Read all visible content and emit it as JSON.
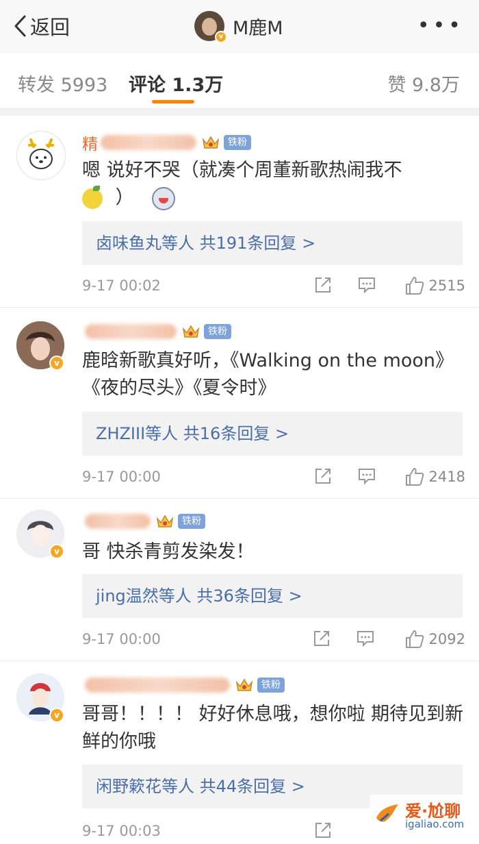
{
  "header": {
    "back_label": "返回",
    "title": "M鹿M",
    "more": "•••"
  },
  "tabs": [
    {
      "label": "转发 5993",
      "active": false
    },
    {
      "label": "评论 1.3万",
      "active": true
    },
    {
      "label": "赞 9.8万",
      "active": false
    }
  ],
  "comments": [
    {
      "username": "精",
      "badge": "铁粉",
      "text_line1": "嗯 说好不哭（就凑个周董新歌热闹我不",
      "text_line2": "）",
      "reply": "卤味鱼丸等人  共191条回复 >",
      "date": "9-17 00:02",
      "likes": "2515"
    },
    {
      "username": "",
      "badge": "铁粉",
      "text": "鹿晗新歌真好听，《Walking on the moon》《夜的尽头》《夏令时》",
      "reply": "ZHZIII等人  共16条回复 >",
      "date": "9-17 00:00",
      "likes": "2418"
    },
    {
      "username": "",
      "badge": "铁粉",
      "text": "哥 快杀青剪发染发！",
      "reply": "jing温然等人  共36条回复 >",
      "date": "9-17 00:00",
      "likes": "2092"
    },
    {
      "username": "",
      "badge": "铁粉",
      "text": "哥哥！！！！ 好好休息哦，想你啦 期待见到新鲜的你哦",
      "reply": "闲野簌花等人  共44条回复 >",
      "date": "9-17 00:03",
      "likes": ""
    }
  ],
  "watermark": {
    "title": "爱·尬聊",
    "url": "igaliao.com"
  },
  "colors": {
    "accent": "#ff8200",
    "username": "#e86a2a",
    "link": "#4a6ea8",
    "verified": "#f5a623"
  }
}
